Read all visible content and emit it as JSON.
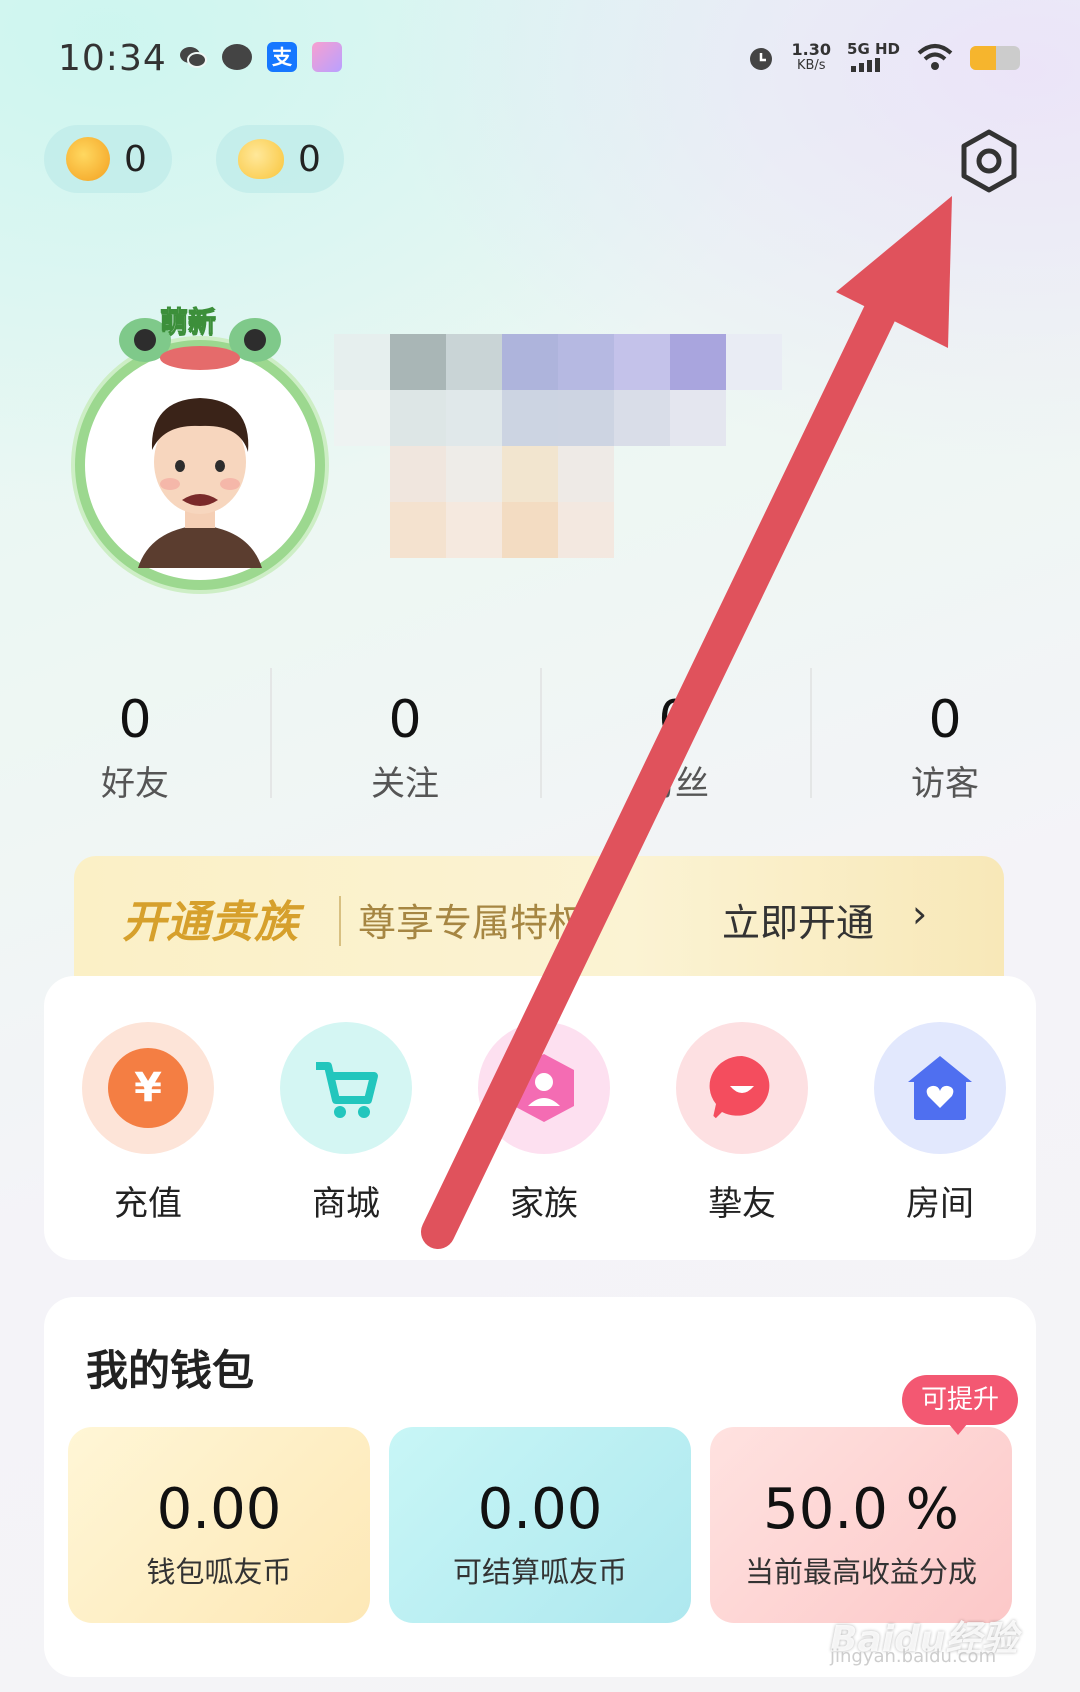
{
  "status_bar": {
    "time": "10:34",
    "speed_value": "1.30",
    "speed_unit": "KB/s",
    "network": "5G HD"
  },
  "currency": {
    "coin_count": "0",
    "duck_count": "0"
  },
  "profile": {
    "badge": "萌新"
  },
  "stats": [
    {
      "value": "0",
      "label": "好友"
    },
    {
      "value": "0",
      "label": "关注"
    },
    {
      "value": "0",
      "label": "粉丝"
    },
    {
      "value": "0",
      "label": "访客"
    }
  ],
  "vip_banner": {
    "title": "开通贵族",
    "subtitle": "尊享专属特权",
    "cta": "立即开通",
    "chevron": "›"
  },
  "features": [
    {
      "label": "充值",
      "icon": "recharge-yen-icon",
      "color": "#f47e43"
    },
    {
      "label": "商城",
      "icon": "cart-icon",
      "color": "#22c6bd"
    },
    {
      "label": "家族",
      "icon": "family-icon",
      "color": "#f46cb3"
    },
    {
      "label": "挚友",
      "icon": "close-friend-icon",
      "color": "#f44d5e"
    },
    {
      "label": "房间",
      "icon": "room-house-icon",
      "color": "#4f6ff0"
    }
  ],
  "wallet": {
    "title": "我的钱包",
    "upgrade_tag": "可提升",
    "cards": [
      {
        "value": "0.00",
        "label": "钱包呱友币"
      },
      {
        "value": "0.00",
        "label": "可结算呱友币"
      },
      {
        "value": "50.0 %",
        "label": "当前最高收益分成"
      }
    ]
  },
  "watermark": {
    "brand": "Baidu经验",
    "domain": "jingyan.baidu.com"
  }
}
